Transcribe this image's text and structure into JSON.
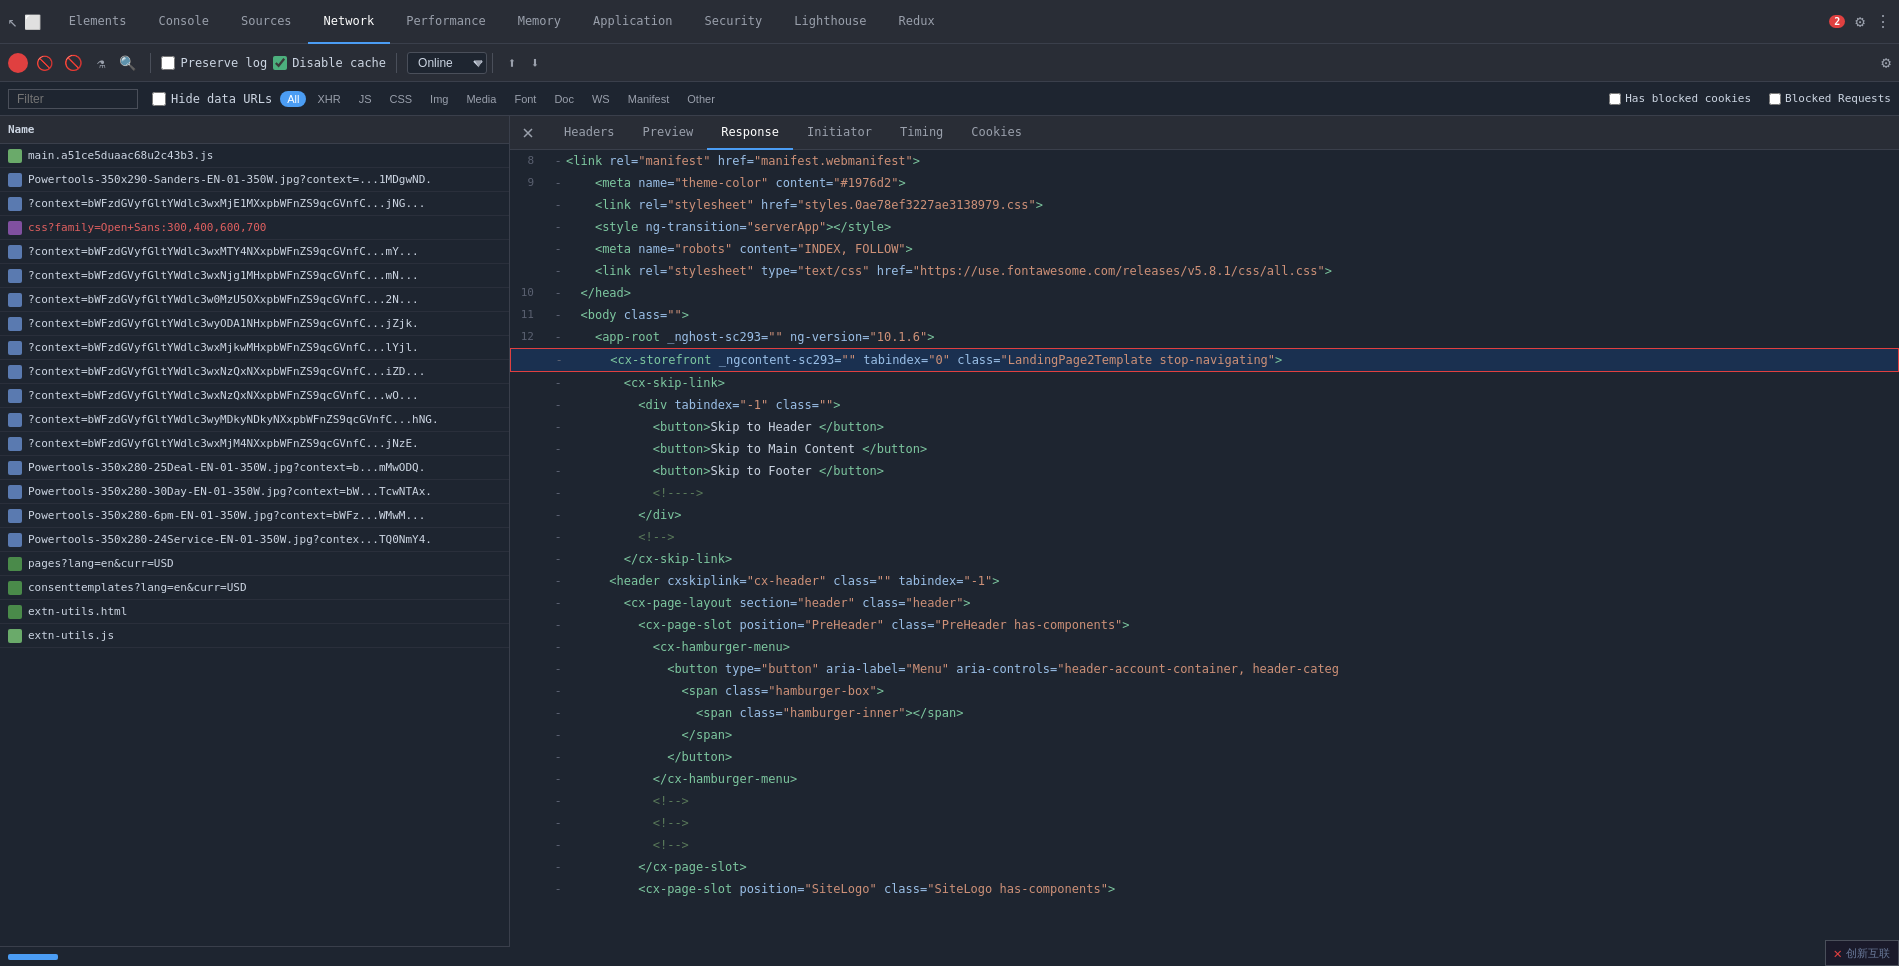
{
  "tabs": {
    "items": [
      {
        "label": "Elements",
        "active": false
      },
      {
        "label": "Console",
        "active": false
      },
      {
        "label": "Sources",
        "active": false
      },
      {
        "label": "Network",
        "active": true
      },
      {
        "label": "Performance",
        "active": false
      },
      {
        "label": "Memory",
        "active": false
      },
      {
        "label": "Application",
        "active": false
      },
      {
        "label": "Security",
        "active": false
      },
      {
        "label": "Lighthouse",
        "active": false
      },
      {
        "label": "Redux",
        "active": false
      }
    ],
    "error_count": "2"
  },
  "toolbar": {
    "preserve_log_label": "Preserve log",
    "disable_cache_label": "Disable cache",
    "online_label": "Online"
  },
  "filter": {
    "placeholder": "Filter",
    "hide_data_urls_label": "Hide data URLs",
    "types": [
      "All",
      "XHR",
      "JS",
      "CSS",
      "Img",
      "Media",
      "Font",
      "Doc",
      "WS",
      "Manifest",
      "Other"
    ],
    "active_type": "All",
    "has_blocked_cookies_label": "Has blocked cookies",
    "blocked_requests_label": "Blocked Requests"
  },
  "network_list": {
    "header": "Name",
    "items": [
      {
        "name": "main.a51ce5duaac68u2c43b3.js",
        "type": "js",
        "color": "normal"
      },
      {
        "name": "Powertools-350x290-Sanders-EN-01-350W.jpg?context=...1MDgwND.",
        "type": "img",
        "color": "normal"
      },
      {
        "name": "?context=bWFzdGVyfGltYWdlc3wxMjE1MXxpbWFnZS9qcGVnfC...jNG...",
        "type": "img",
        "color": "normal"
      },
      {
        "name": "css?family=Open+Sans:300,400,600,700",
        "type": "css",
        "color": "red"
      },
      {
        "name": "?context=bWFzdGVyfGltYWdlc3wxMTY4NXxpbWFnZS9qcGVnfC...mY...",
        "type": "img",
        "color": "normal"
      },
      {
        "name": "?context=bWFzdGVyfGltYWdlc3wxNjg1MHxpbWFnZS9qcGVnfC...mN...",
        "type": "img",
        "color": "normal"
      },
      {
        "name": "?context=bWFzdGVyfGltYWdlc3w0MzU5OXxpbWFnZS9qcGVnfC...2N...",
        "type": "img",
        "color": "normal"
      },
      {
        "name": "?context=bWFzdGVyfGltYWdlc3wyODA1NHxpbWFnZS9qcGVnfC...jZjk.",
        "type": "img",
        "color": "normal"
      },
      {
        "name": "?context=bWFzdGVyfGltYWdlc3wxMjkwMHxpbWFnZS9qcGVnfC...lYjl.",
        "type": "img",
        "color": "normal"
      },
      {
        "name": "?context=bWFzdGVyfGltYWdlc3wxNzQxNXxpbWFnZS9qcGVnfC...iZD...",
        "type": "img",
        "color": "normal"
      },
      {
        "name": "?context=bWFzdGVyfGltYWdlc3wxNzQxNXxpbWFnZS9qcGVnfC...wO...",
        "type": "img",
        "color": "normal"
      },
      {
        "name": "?context=bWFzdGVyfGltYWdlc3wyMDkyNDkyNXxpbWFnZS9qcGVnfC...hNG.",
        "type": "img",
        "color": "normal"
      },
      {
        "name": "?context=bWFzdGVyfGltYWdlc3wxMjM4NXxpbWFnZS9qcGVnfC...jNzE.",
        "type": "img",
        "color": "normal"
      },
      {
        "name": "Powertools-350x280-25Deal-EN-01-350W.jpg?context=b...mMwODQ.",
        "type": "img",
        "color": "normal"
      },
      {
        "name": "Powertools-350x280-30Day-EN-01-350W.jpg?context=bW...TcwNTAx.",
        "type": "img",
        "color": "normal"
      },
      {
        "name": "Powertools-350x280-6pm-EN-01-350W.jpg?context=bWFz...WMwM...",
        "type": "img",
        "color": "normal"
      },
      {
        "name": "Powertools-350x280-24Service-EN-01-350W.jpg?contex...TQ0NmY4.",
        "type": "img",
        "color": "normal"
      },
      {
        "name": "pages?lang=en&curr=USD",
        "type": "doc",
        "color": "normal"
      },
      {
        "name": "consenttemplates?lang=en&curr=USD",
        "type": "doc",
        "color": "normal"
      },
      {
        "name": "extn-utils.html",
        "type": "doc",
        "color": "normal"
      },
      {
        "name": "extn-utils.js",
        "type": "js",
        "color": "normal"
      }
    ]
  },
  "response_panel": {
    "tabs": [
      "Headers",
      "Preview",
      "Response",
      "Initiator",
      "Timing",
      "Cookies"
    ],
    "active_tab": "Response"
  },
  "code_lines": [
    {
      "num": "",
      "arrow": "",
      "indent": 0,
      "content": "",
      "type": "blank"
    },
    {
      "num": "8",
      "arrow": "-",
      "indent": 3,
      "content": "<link rel=\"manifest\" href=\"manifest.webmanifest\">",
      "type": "tag",
      "line": 1
    },
    {
      "num": "9",
      "arrow": "-",
      "indent": 3,
      "content": "<meta name=\"theme-color\" content=\"#1976d2\">",
      "type": "tag",
      "line": 2
    },
    {
      "num": "",
      "arrow": "-",
      "indent": 3,
      "content": "<link rel=\"stylesheet\" href=\"styles.0ae78ef3227ae3138979.css\">",
      "type": "tag",
      "line": 3
    },
    {
      "num": "",
      "arrow": "-",
      "indent": 3,
      "content": "<style ng-transition=\"serverApp\"></style>",
      "type": "tag",
      "line": 4
    },
    {
      "num": "",
      "arrow": "-",
      "indent": 3,
      "content": "<meta name=\"robots\" content=\"INDEX, FOLLOW\">",
      "type": "tag",
      "line": 5
    },
    {
      "num": "",
      "arrow": "-",
      "indent": 3,
      "content": "<link rel=\"stylesheet\" type=\"text/css\" href=\"https://use.fontawesome.com/releases/v5.8.1/css/all.css\">",
      "type": "tag",
      "line": 6
    },
    {
      "num": "10",
      "arrow": "-",
      "indent": 2,
      "content": "</head>",
      "type": "closetag",
      "line": 7
    },
    {
      "num": "11",
      "arrow": "-",
      "indent": 2,
      "content": "<body class=\"\">",
      "type": "tag",
      "line": 8
    },
    {
      "num": "12",
      "arrow": "-",
      "indent": 3,
      "content": "<app-root _nghost-sc293=\"\" ng-version=\"10.1.6\">",
      "type": "tag",
      "line": 9
    },
    {
      "num": "",
      "arrow": "-",
      "indent": 4,
      "content": "<cx-storefront _ngcontent-sc293=\"\" tabindex=\"0\" class=\"LandingPage2Template stop-navigating\">",
      "type": "highlighted_tag",
      "line": 10
    },
    {
      "num": "",
      "arrow": "-",
      "indent": 5,
      "content": "<cx-skip-link>",
      "type": "tag",
      "line": 11
    },
    {
      "num": "",
      "arrow": "-",
      "indent": 6,
      "content": "<div tabindex=\"-1\" class=\"\">",
      "type": "tag",
      "line": 12
    },
    {
      "num": "",
      "arrow": "-",
      "indent": 7,
      "content": "<button>Skip to Header </button>",
      "type": "tag",
      "line": 13
    },
    {
      "num": "",
      "arrow": "-",
      "indent": 7,
      "content": "<button>Skip to Main Content </button>",
      "type": "tag",
      "line": 14
    },
    {
      "num": "",
      "arrow": "-",
      "indent": 7,
      "content": "<button>Skip to Footer </button>",
      "type": "tag",
      "line": 15
    },
    {
      "num": "",
      "arrow": "-",
      "indent": 7,
      "content": "<!---->\n",
      "type": "comment",
      "line": 16
    },
    {
      "num": "",
      "arrow": "-",
      "indent": 6,
      "content": "</div>",
      "type": "closetag",
      "line": 17
    },
    {
      "num": "",
      "arrow": "-",
      "indent": 6,
      "content": "<!-->",
      "type": "comment",
      "line": 18
    },
    {
      "num": "",
      "arrow": "-",
      "indent": 5,
      "content": "</cx-skip-link>",
      "type": "closetag",
      "line": 19
    },
    {
      "num": "",
      "arrow": "-",
      "indent": 4,
      "content": "<header cxskiplink=\"cx-header\" class=\"\" tabindex=\"-1\">",
      "type": "tag",
      "line": 20
    },
    {
      "num": "",
      "arrow": "-",
      "indent": 5,
      "content": "<cx-page-layout section=\"header\" class=\"header\">",
      "type": "tag",
      "line": 21
    },
    {
      "num": "",
      "arrow": "-",
      "indent": 6,
      "content": "<cx-page-slot position=\"PreHeader\" class=\"PreHeader has-components\">",
      "type": "tag",
      "line": 22
    },
    {
      "num": "",
      "arrow": "-",
      "indent": 7,
      "content": "<cx-hamburger-menu>",
      "type": "tag",
      "line": 23
    },
    {
      "num": "",
      "arrow": "-",
      "indent": 8,
      "content": "<button type=\"button\" aria-label=\"Menu\" aria-controls=\"header-account-container, header-categ",
      "type": "tag",
      "line": 24
    },
    {
      "num": "",
      "arrow": "-",
      "indent": 9,
      "content": "<span class=\"hamburger-box\">",
      "type": "tag",
      "line": 25
    },
    {
      "num": "",
      "arrow": "-",
      "indent": 10,
      "content": "<span class=\"hamburger-inner\"></span>",
      "type": "tag",
      "line": 26
    },
    {
      "num": "",
      "arrow": "-",
      "indent": 9,
      "content": "</span>",
      "type": "closetag",
      "line": 27
    },
    {
      "num": "",
      "arrow": "-",
      "indent": 8,
      "content": "</button>",
      "type": "closetag",
      "line": 28
    },
    {
      "num": "",
      "arrow": "-",
      "indent": 7,
      "content": "</cx-hamburger-menu>",
      "type": "closetag",
      "line": 29
    },
    {
      "num": "",
      "arrow": "-",
      "indent": 7,
      "content": "<!-->",
      "type": "comment",
      "line": 30
    },
    {
      "num": "",
      "arrow": "-",
      "indent": 7,
      "content": "<!-->",
      "type": "comment",
      "line": 31
    },
    {
      "num": "",
      "arrow": "-",
      "indent": 7,
      "content": "<!-->",
      "type": "comment",
      "line": 32
    },
    {
      "num": "",
      "arrow": "-",
      "indent": 6,
      "content": "</cx-page-slot>",
      "type": "closetag",
      "line": 33
    },
    {
      "num": "",
      "arrow": "-",
      "indent": 6,
      "content": "<cx-page-slot position=\"SiteLogo\" class=\"SiteLogo has-components\">",
      "type": "tag",
      "line": 34
    }
  ],
  "watermark": {
    "label": "创新互联",
    "sublabel": ""
  }
}
